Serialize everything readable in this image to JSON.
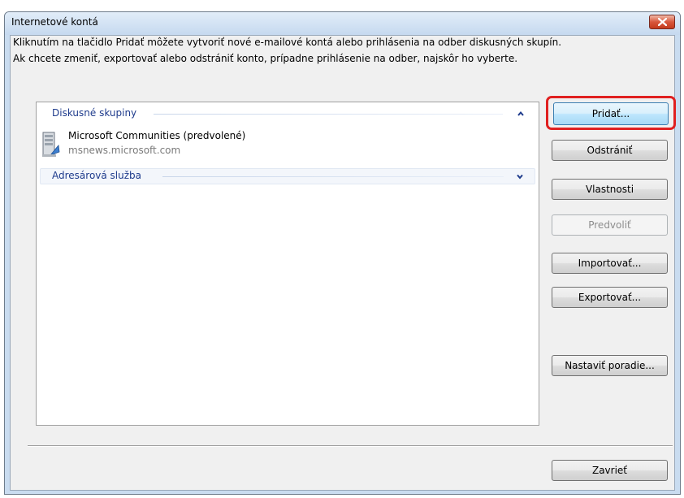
{
  "window": {
    "title": "Internetové kontá"
  },
  "description": {
    "line1": "Kliknutím na tlačidlo Pridať môžete vytvoriť nové e-mailové kontá alebo prihlásenia na odber diskusných skupín.",
    "line2": "Ak chcete zmeniť, exportovať alebo odstrániť konto, prípadne prihlásenie na odber, najskôr ho vyberte."
  },
  "accounts_list": {
    "groups": [
      {
        "label": "Diskusné skupiny",
        "expanded": true,
        "items": [
          {
            "name": "Microsoft Communities (predvolené)",
            "server": "msnews.microsoft.com"
          }
        ]
      },
      {
        "label": "Adresárová služba",
        "expanded": false,
        "items": []
      }
    ]
  },
  "buttons": {
    "add": "Pridať...",
    "remove": "Odstrániť",
    "properties": "Vlastnosti",
    "set_default": "Predvoliť",
    "import": "Importovať...",
    "export": "Exportovať...",
    "set_order": "Nastaviť poradie...",
    "close": "Zavrieť"
  },
  "colors": {
    "highlight": "#e02020",
    "group_header_text": "#1e3b8c",
    "close_button": "#c43a1c"
  },
  "icons": {
    "close": "close-x-icon",
    "collapse": "chevron-up-icon",
    "expand": "chevron-down-icon",
    "news_server": "news-server-icon"
  }
}
